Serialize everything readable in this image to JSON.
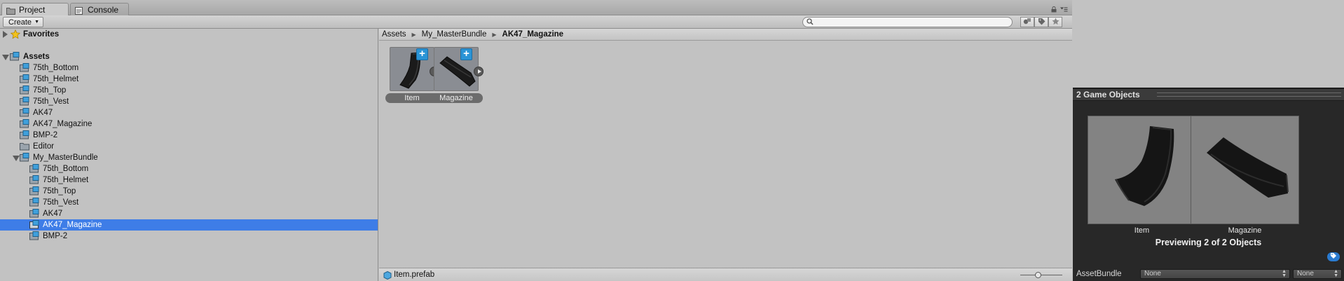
{
  "tabs": [
    {
      "label": "Project",
      "icon": "folder-icon",
      "active": true
    },
    {
      "label": "Console",
      "icon": "console-icon",
      "active": false
    }
  ],
  "toolbar": {
    "create_label": "Create",
    "search_placeholder": "",
    "search_value": ""
  },
  "tree": {
    "favorites": {
      "label": "Favorites",
      "icon": "star-icon",
      "expanded": false
    },
    "root": {
      "label": "Assets",
      "expanded": true
    },
    "items": [
      {
        "label": "75th_Bottom",
        "level": 1,
        "icon": "prefab-folder-icon"
      },
      {
        "label": "75th_Helmet",
        "level": 1,
        "icon": "prefab-folder-icon"
      },
      {
        "label": "75th_Top",
        "level": 1,
        "icon": "prefab-folder-icon"
      },
      {
        "label": "75th_Vest",
        "level": 1,
        "icon": "prefab-folder-icon"
      },
      {
        "label": "AK47",
        "level": 1,
        "icon": "prefab-folder-icon"
      },
      {
        "label": "AK47_Magazine",
        "level": 1,
        "icon": "prefab-folder-icon"
      },
      {
        "label": "BMP-2",
        "level": 1,
        "icon": "prefab-folder-icon"
      },
      {
        "label": "Editor",
        "level": 1,
        "icon": "folder-icon"
      },
      {
        "label": "My_MasterBundle",
        "level": 1,
        "icon": "prefab-folder-icon",
        "expanded": true
      },
      {
        "label": "75th_Bottom",
        "level": 2,
        "icon": "prefab-folder-icon"
      },
      {
        "label": "75th_Helmet",
        "level": 2,
        "icon": "prefab-folder-icon"
      },
      {
        "label": "75th_Top",
        "level": 2,
        "icon": "prefab-folder-icon"
      },
      {
        "label": "75th_Vest",
        "level": 2,
        "icon": "prefab-folder-icon"
      },
      {
        "label": "AK47",
        "level": 2,
        "icon": "prefab-folder-icon"
      },
      {
        "label": "AK47_Magazine",
        "level": 2,
        "icon": "prefab-folder-icon",
        "selected": true
      },
      {
        "label": "BMP-2",
        "level": 2,
        "icon": "prefab-folder-icon"
      }
    ]
  },
  "breadcrumb": [
    "Assets",
    "My_MasterBundle",
    "AK47_Magazine"
  ],
  "assets": [
    {
      "label": "Item",
      "icon": "magazine-thumbnail"
    },
    {
      "label": "Magazine",
      "icon": "magazine-thumbnail"
    }
  ],
  "status": {
    "file": "Item.prefab",
    "zoom_fraction": 0.42
  },
  "inspector": {
    "title": "2 Game Objects",
    "previews": [
      {
        "label": "Item"
      },
      {
        "label": "Magazine"
      }
    ],
    "preview_status": "Previewing 2 of 2 Objects",
    "assetbundle_label": "AssetBundle",
    "assetbundle_name": "None",
    "assetbundle_variant": "None"
  },
  "colors": {
    "selection": "#3e7de7",
    "panel": "#c2c2c2",
    "inspector_bg": "#282828",
    "plus_badge": "#2a94d6"
  }
}
